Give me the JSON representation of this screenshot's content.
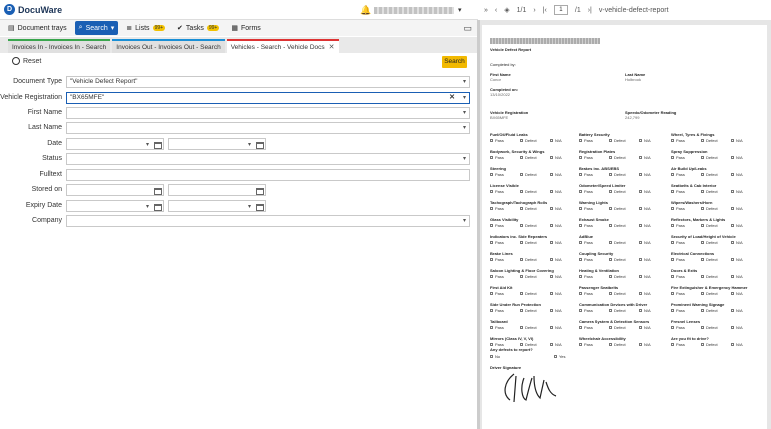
{
  "app": {
    "name": "DocuWare"
  },
  "viewer": {
    "page_current": "1",
    "page_total_a": "1/1",
    "page_total_b": "/1",
    "doc_name": "v-vehicle-defect-report"
  },
  "toolbar": {
    "document_trays": "Document trays",
    "search": "Search",
    "lists": "Lists",
    "lists_badge": "99+",
    "tasks": "Tasks",
    "tasks_badge": "99+",
    "forms": "Forms"
  },
  "tabs": [
    {
      "label": "Invoices In - Invoices In - Search"
    },
    {
      "label": "Invoices Out - Invoices Out - Search"
    },
    {
      "label": "Vehicles - Search - Vehicle Docs"
    }
  ],
  "search_panel": {
    "reset_label": "Reset",
    "search_button": "Search",
    "fields": {
      "document_type": {
        "label": "Document Type",
        "value": "\"Vehicle Defect Report\""
      },
      "vehicle_registration": {
        "label": "Vehicle Registration",
        "value": "\"BX65MFE\""
      },
      "first_name": {
        "label": "First Name",
        "value": ""
      },
      "last_name": {
        "label": "Last Name",
        "value": ""
      },
      "date": {
        "label": "Date"
      },
      "status": {
        "label": "Status",
        "value": ""
      },
      "fulltext": {
        "label": "Fulltext",
        "value": ""
      },
      "stored_on": {
        "label": "Stored on"
      },
      "expiry_date": {
        "label": "Expiry Date"
      },
      "company": {
        "label": "Company",
        "value": ""
      }
    }
  },
  "document": {
    "title": "Vehicle Defect Report",
    "completed_by": "Completed by:",
    "first_name_label": "First Name",
    "first_name_value": "Conor",
    "last_name_label": "Last Name",
    "last_name_value": "Holbrook",
    "completed_on_label": "Completed on:",
    "completed_on_value": "13/10/2022",
    "reg_label": "Vehicle Registration",
    "reg_value": "BX65MFE",
    "odo_label": "Speedo/Odometer Reading",
    "odo_value": "242,799",
    "pass": "Pass",
    "defect": "Defect",
    "na": "N/A",
    "checks": [
      [
        "Fuel/Oil/Fluid Leaks",
        "Battery Security",
        "Wheel, Tyres & Fixings"
      ],
      [
        "Bodywork, Security & Wings",
        "Registration Plates",
        "Spray Suppression"
      ],
      [
        "Steering",
        "Brakes inc. ABS/EBS",
        "Air Build Up/Leaks"
      ],
      [
        "License Visible",
        "Odometer/Speed Limiter",
        "Seatbelts & Cab Interior"
      ],
      [
        "Tachograph/Tachograph Rolls",
        "Warning Lights",
        "Wipers/Washers/Horn"
      ],
      [
        "Glass Visibility",
        "Exhaust Smoke",
        "Reflectors, Markers & Lights"
      ],
      [
        "Indicators inc. Side Repeaters",
        "AdBlue",
        "Security of Load/Height of Vehicle"
      ],
      [
        "Brake Lines",
        "Coupling Security",
        "Electrical Connections"
      ],
      [
        "Saloon Lighting & Floor Covering",
        "Heating & Ventilation",
        "Doors & Exits"
      ],
      [
        "First Aid Kit",
        "Passenger Seatbelts",
        "Fire Extinguisher & Emergency Hammer"
      ],
      [
        "Side Under Run Protection",
        "Communication Devices with Driver",
        "Prominent Warning Signage"
      ],
      [
        "Tailboard",
        "Camera System & Detection Sensors",
        "Fresnel Lenses"
      ],
      [
        "Mirrors (Class IV, V, VI)",
        "Wheelchair Accessibility",
        "Are you fit to drive?"
      ]
    ],
    "defects_q": "Any defects to report?",
    "no": "No",
    "yes": "Yes",
    "driver_signature": "Driver Signature"
  }
}
